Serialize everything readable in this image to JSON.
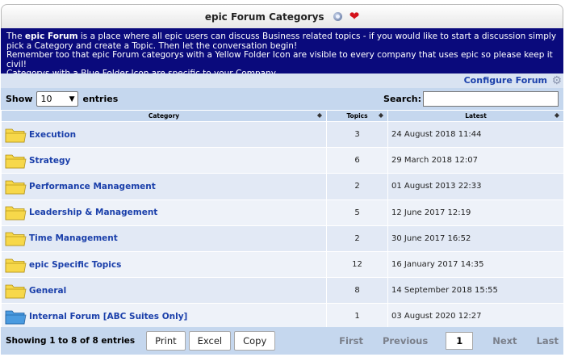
{
  "header": {
    "title": "epic Forum Categorys",
    "info_icon": "info-icon",
    "favorite_icon": "heart-icon"
  },
  "intro": {
    "line1_pre": "The ",
    "line1_bold": "epic Forum",
    "line1_post": " is a place where all epic users can discuss Business related topics - if you would like to start a discussion simply pick a Category and create a Topic. Then let the conversation begin!",
    "line2": "Remember too that epic Forum categorys with a Yellow Folder Icon are visible to every company that uses epic so please keep it civil!",
    "line3": "Categorys with a Blue Folder Icon are specific to your Company."
  },
  "config": {
    "link": "Configure Forum",
    "icon": "gear-icon"
  },
  "controls": {
    "show_label": "Show",
    "entries_value": "10",
    "entries_label": "entries",
    "search_label": "Search:",
    "search_value": ""
  },
  "table": {
    "columns": [
      "Category",
      "Topics",
      "Latest"
    ],
    "rows": [
      {
        "category": "Execution",
        "topics": "3",
        "latest": "24 August 2018 11:44",
        "folder": "yellow"
      },
      {
        "category": "Strategy",
        "topics": "6",
        "latest": "29 March 2018 12:07",
        "folder": "yellow"
      },
      {
        "category": "Performance Management",
        "topics": "2",
        "latest": "01 August 2013 22:33",
        "folder": "yellow"
      },
      {
        "category": "Leadership & Management",
        "topics": "5",
        "latest": "12 June 2017 12:19",
        "folder": "yellow"
      },
      {
        "category": "Time Management",
        "topics": "2",
        "latest": "30 June 2017 16:52",
        "folder": "yellow"
      },
      {
        "category": "epic Specific Topics",
        "topics": "12",
        "latest": "16 January 2017 14:35",
        "folder": "yellow"
      },
      {
        "category": "General",
        "topics": "8",
        "latest": "14 September 2018 15:55",
        "folder": "yellow"
      },
      {
        "category": "Internal Forum [ABC Suites Only]",
        "topics": "1",
        "latest": "03 August 2020 12:27",
        "folder": "blue"
      }
    ]
  },
  "footer": {
    "info": "Showing 1 to 8 of 8 entries",
    "buttons": [
      "Print",
      "Excel",
      "Copy"
    ],
    "pager": {
      "first": "First",
      "previous": "Previous",
      "current": "1",
      "next": "Next",
      "last": "Last"
    }
  },
  "colors": {
    "intro_bg": "#0a0a7c",
    "link": "#1a3faa",
    "folder_yellow": "#f7d84a",
    "folder_blue": "#4a9be0",
    "heart": "#d4111b"
  }
}
